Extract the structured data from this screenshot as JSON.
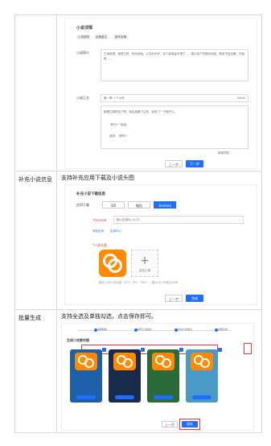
{
  "row1": {
    "section_title": "小说详情",
    "tags": [
      "小说类别",
      "言情重生",
      "都市言情"
    ],
    "intro_label": "小说简介",
    "intro_text": "王海觉得，他恨打败，别无他选，人夫妇不好，这个影事者不想了……想么找个宅想尽可能，受苦不复也罢，不能再……",
    "excerpt_label": "小说正文",
    "excerpt_title": "第一章 一个小时",
    "excerpt_count": "0/500",
    "excerpt_lines": [
      "刚想打算再说了吧，就见她看了过来，轻笑了一下就开口。",
      "“阿行？”她说。",
      "我说：“那你？”"
    ],
    "checkbox_label": "阅读须知",
    "prev_label": "上一步",
    "next_label": "下一步"
  },
  "row2": {
    "label": "补充小说信息",
    "desc": "支持补充应用下载及小说头图",
    "panel_title": "补充小说下载信息",
    "app_label": "应用下载",
    "tabs": [
      "iOS",
      "微信",
      "Android"
    ],
    "android_label": "*Android",
    "android_value": "输入应用ID（A-Z）",
    "link_add": "添加应用",
    "link_store": "应用中心",
    "cover_label": "*小说头图",
    "upload_text": "点击上传",
    "hint_text": "建议上传小说头图（尺寸：JPG、PNG），图片大小不超过5MB。",
    "prev_label": "上一步",
    "finish_label": "完成"
  },
  "row3": {
    "label": "批量生成",
    "desc": "支持全选及单独勾选，点击保存即可。",
    "steps": [
      "选择模板",
      "填写小说信息",
      "补充小说信息",
      "批量生成"
    ],
    "sub_title": "生成小说素材图",
    "card_colors": [
      "#1f5fa8",
      "#1a2a4a",
      "#2c6a3a",
      "#4a9ac8"
    ],
    "prev_label": "上一步",
    "save_label": "保存"
  },
  "colors": {
    "primary": "#1e6fff",
    "accent": "#ff8a00",
    "highlight": "#e53935"
  }
}
